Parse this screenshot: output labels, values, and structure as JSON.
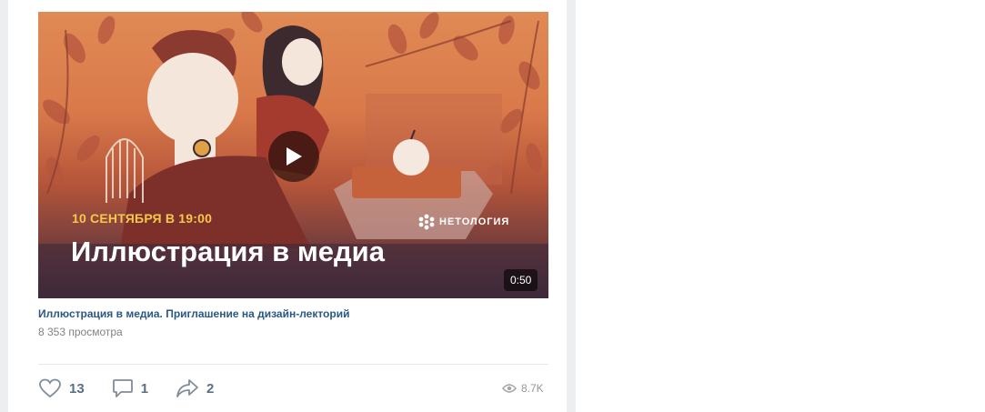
{
  "video": {
    "promo_date": "10 СЕНТЯБРЯ В 19:00",
    "promo_title": "Иллюстрация в медиа",
    "brand": "НЕТОЛОГИЯ",
    "duration": "0:50",
    "caption": "Иллюстрация в медиа. Приглашение на дизайн-лекторий",
    "views_text": "8 353 просмотра"
  },
  "actions": {
    "likes": "13",
    "comments": "1",
    "shares": "2",
    "views": "8.7K"
  },
  "icons": [
    "heart-icon",
    "comment-icon",
    "share-icon",
    "eye-icon",
    "play-icon",
    "netology-logo-icon"
  ],
  "colors": {
    "link": "#2a5885",
    "action": "#5a6f87",
    "muted": "#828282",
    "promo_date": "#f6c84a",
    "page_bg": "#edeef0"
  }
}
